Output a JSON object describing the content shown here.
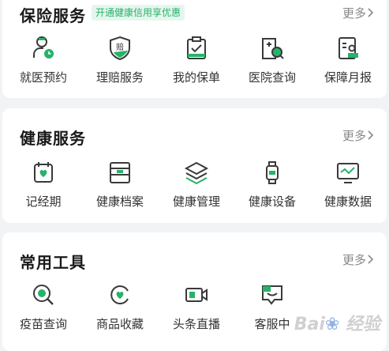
{
  "colors": {
    "accent": "#27b26a",
    "icon_stroke": "#3a3a3a",
    "text": "#333333"
  },
  "insurance": {
    "title": "保险服务",
    "promo": "开通健康信用享优惠",
    "more": "更多",
    "items": [
      {
        "label": "就医预约",
        "icon": "doctor-icon"
      },
      {
        "label": "理赔服务",
        "icon": "claim-shield-icon"
      },
      {
        "label": "我的保单",
        "icon": "clipboard-icon"
      },
      {
        "label": "医院查询",
        "icon": "hospital-search-icon"
      },
      {
        "label": "保障月报",
        "icon": "report-icon"
      }
    ]
  },
  "health": {
    "title": "健康服务",
    "more": "更多",
    "items": [
      {
        "label": "记经期",
        "icon": "calendar-heart-icon"
      },
      {
        "label": "健康档案",
        "icon": "archive-icon"
      },
      {
        "label": "健康管理",
        "icon": "layers-icon"
      },
      {
        "label": "健康设备",
        "icon": "watch-icon"
      },
      {
        "label": "健康数据",
        "icon": "monitor-chart-icon"
      }
    ]
  },
  "tools": {
    "title": "常用工具",
    "more": "更多",
    "items": [
      {
        "label": "疫苗查询",
        "icon": "vaccine-search-icon"
      },
      {
        "label": "商品收藏",
        "icon": "favorite-icon"
      },
      {
        "label": "头条直播",
        "icon": "video-icon"
      },
      {
        "label": "客服中",
        "icon": "chat-icon"
      }
    ]
  },
  "watermark": "Baidu 经验"
}
